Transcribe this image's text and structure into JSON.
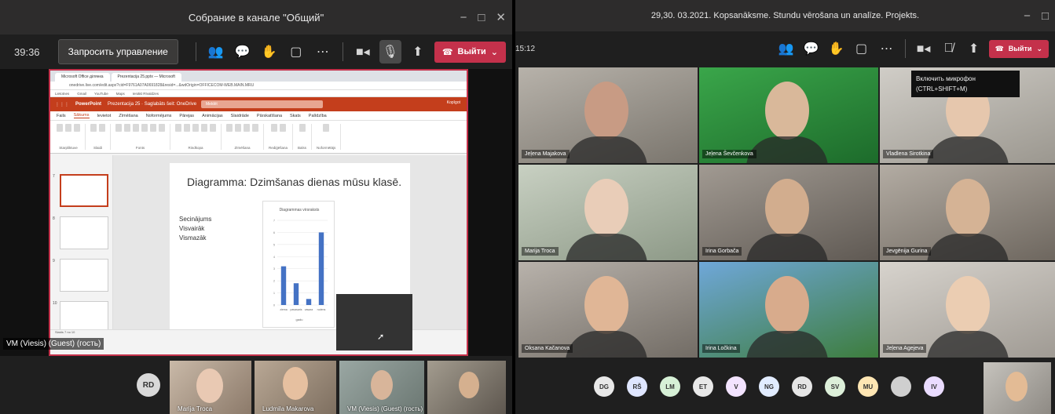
{
  "left": {
    "title": "Собрание в канале \"Общий\"",
    "timer": "39:36",
    "request_control": "Запросить управление",
    "leave": "Выйти",
    "browser": {
      "tabs": [
        "Microsoft Office ділянка",
        "Prezentacija 25.pptx — Microsoft"
      ],
      "address": "onedrive.live.com/edit.aspx?cid=F9761A07A0691828&resid=...&wdOrigin=OFFICECOM-WEB.MAIN.MRU",
      "bookmarks": [
        "Lietotnes",
        "Gmail",
        "YouTube",
        "Maps",
        "Ienākt Rīvaldzes"
      ]
    },
    "ppt": {
      "app": "PowerPoint",
      "file": "Prezentacija 25 · Saglabāts šeit: OneDrive",
      "search": "Meklēt",
      "share": "Kopīgot",
      "ribbon_tabs": [
        "Fails",
        "Sākums",
        "Ievietot",
        "Zīmēšana",
        "Noformējums",
        "Pārejas",
        "Animācijas",
        "Slaidrāde",
        "Pārskatīšana",
        "Skats",
        "Palīdzība"
      ],
      "ribbon_groups": [
        "Starpliktuve",
        "Slaidi",
        "Fonts",
        "Rindkopa",
        "Zīmēšana",
        "Rediģēšana",
        "Balss",
        "Noformētājs"
      ],
      "slide_numbers": [
        "7",
        "8",
        "9",
        "10"
      ],
      "slide": {
        "title": "Diagramma: Dzimšanas dienas mūsu klasē.",
        "lines": [
          "Secinājums",
          "Visvairāk",
          "Vismazāk"
        ]
      },
      "status": "Slaids 7 no 10"
    },
    "name_tag": "VM (Viesis) (Guest) (гость)",
    "strip": {
      "avatar": "RD",
      "tiles": [
        "Marija Troca",
        "Ludmila Makarova",
        "VM (Viesis) (Guest) (гость)"
      ]
    }
  },
  "right": {
    "title": "29,30. 03.2021. Kopsanāksme. Stundu vērošana un analīze. Projekts.",
    "timer": "15:12",
    "leave": "Выйти",
    "tooltip": [
      "Включить микрофон",
      "(CTRL+SHIFT+M)"
    ],
    "tiles": [
      "Jeļena Majakova",
      "Jeļena Ševčenkova",
      "Vladlena Sirotkina",
      "Marija Troca",
      "Irina Gorbača",
      "Jevgēnija Gurina",
      "Oksana Kačanova",
      "Irina Ločkina",
      "Jeļena Agejeva"
    ],
    "avatars": [
      "DG",
      "RŠ",
      "LM",
      "ET",
      "V",
      "NG",
      "RD",
      "SV",
      "MU",
      "",
      "IV"
    ]
  },
  "chart_data": {
    "type": "bar",
    "title": "Diagrammas virsraksts",
    "categories": [
      "ziema",
      "pavasaris",
      "vasara",
      "rudens"
    ],
    "values": [
      3.2,
      1.8,
      0.5,
      6.0
    ],
    "xlabel": "gadu",
    "ylim": [
      0,
      7
    ]
  },
  "colors": {
    "leave": "#c4314b",
    "powerpoint": "#c43e1c",
    "bar": "#4472c4"
  }
}
